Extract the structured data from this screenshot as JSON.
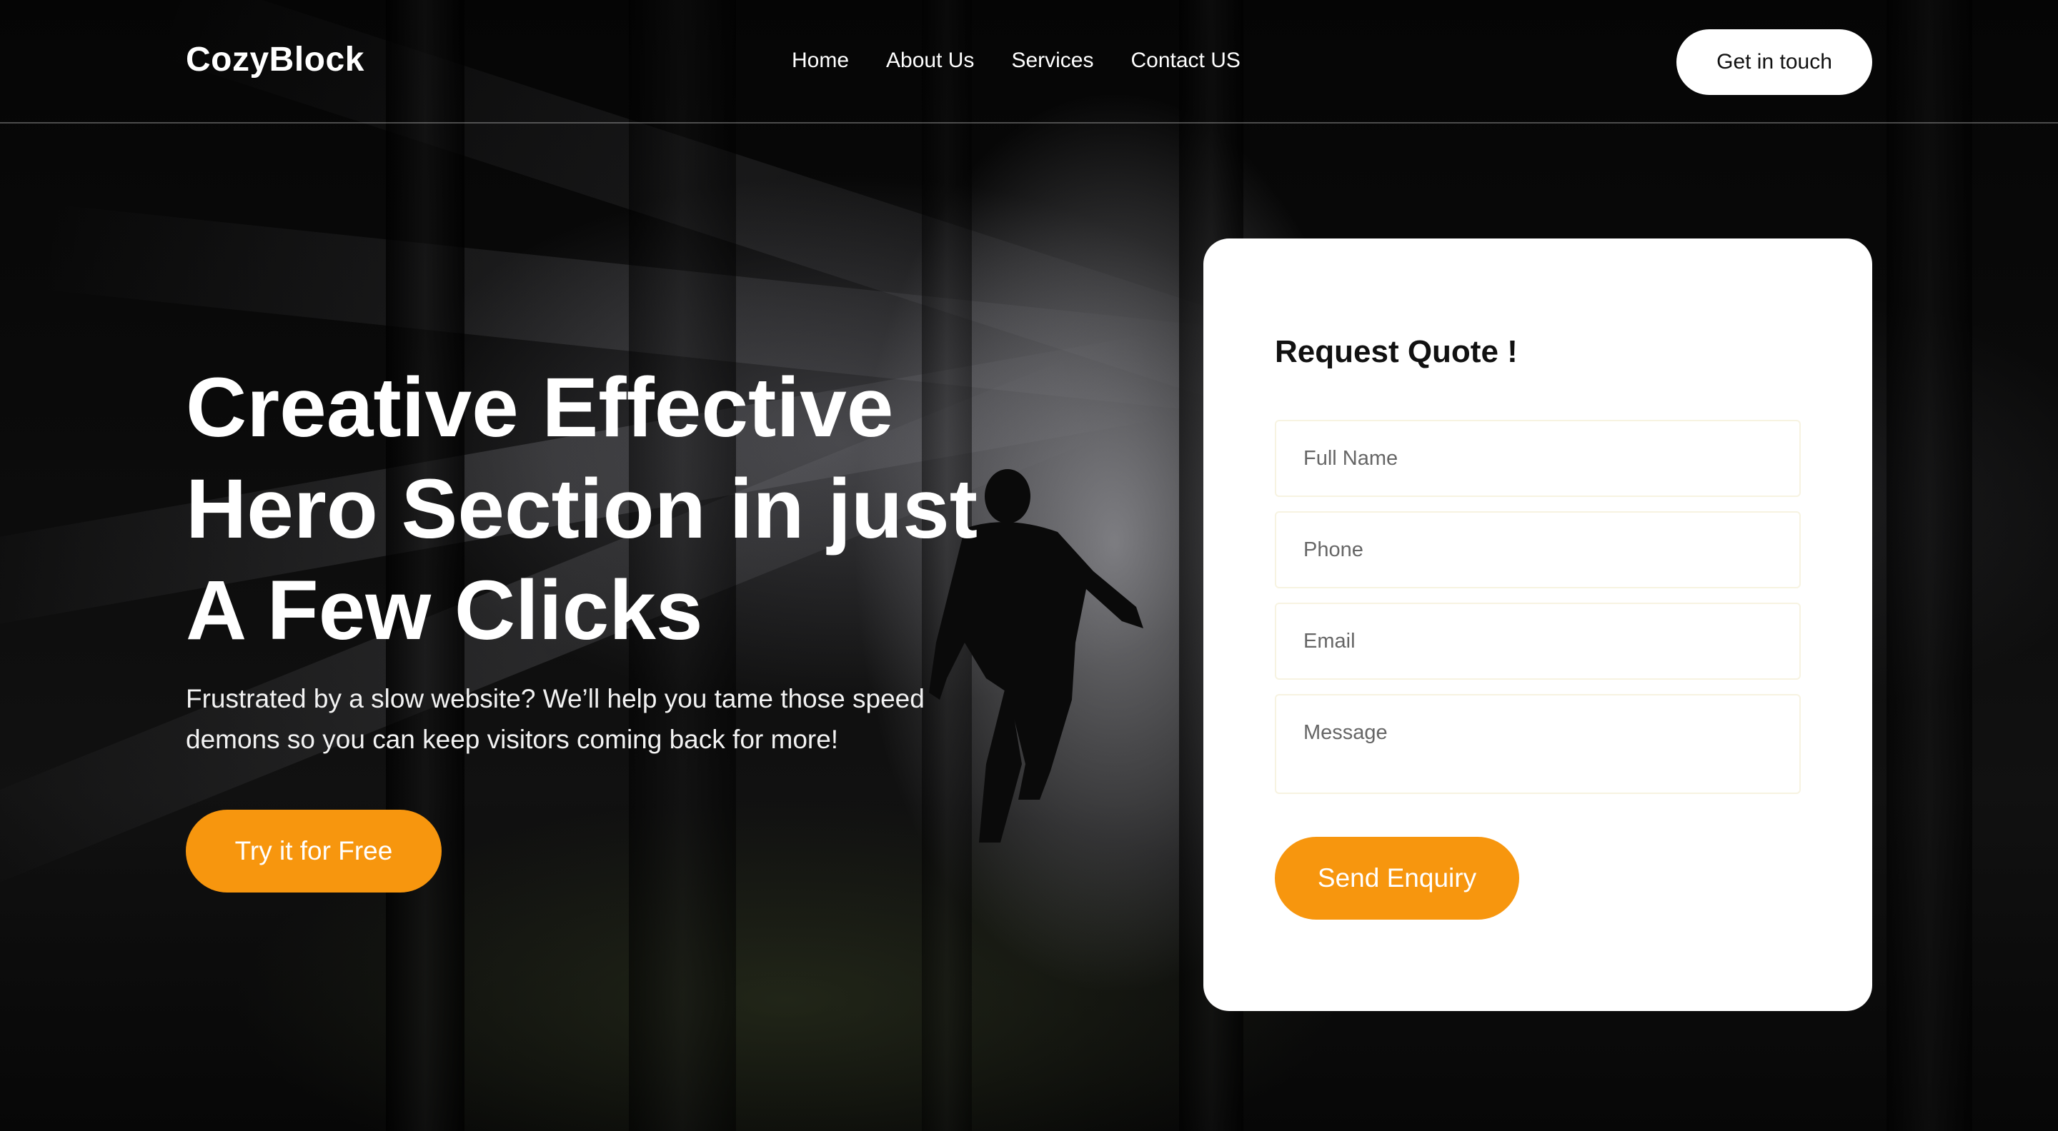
{
  "header": {
    "logo": "CozyBlock",
    "nav": [
      {
        "label": "Home"
      },
      {
        "label": "About Us"
      },
      {
        "label": "Services"
      },
      {
        "label": "Contact US"
      }
    ],
    "cta_label": "Get in touch"
  },
  "hero": {
    "title_lines": [
      "Creative Effective",
      "Hero Section in just",
      "A Few Clicks"
    ],
    "subtitle": "Frustrated by a slow website? We’ll help you tame those speed demons so you can keep visitors coming back for more!",
    "button_label": "Try it for Free",
    "background_description": "dark forest with light rays and silhouette of a running person"
  },
  "quote_form": {
    "title": "Request Quote !",
    "fields": {
      "full_name": {
        "placeholder": "Full Name",
        "value": ""
      },
      "phone": {
        "placeholder": "Phone",
        "value": ""
      },
      "email": {
        "placeholder": "Email",
        "value": ""
      },
      "message": {
        "placeholder": "Message",
        "value": ""
      }
    },
    "submit_label": "Send Enquiry"
  },
  "colors": {
    "accent": "#f7960e",
    "background": "#000000",
    "card": "#ffffff",
    "text_light": "#ffffff",
    "text_dark": "#111111"
  }
}
